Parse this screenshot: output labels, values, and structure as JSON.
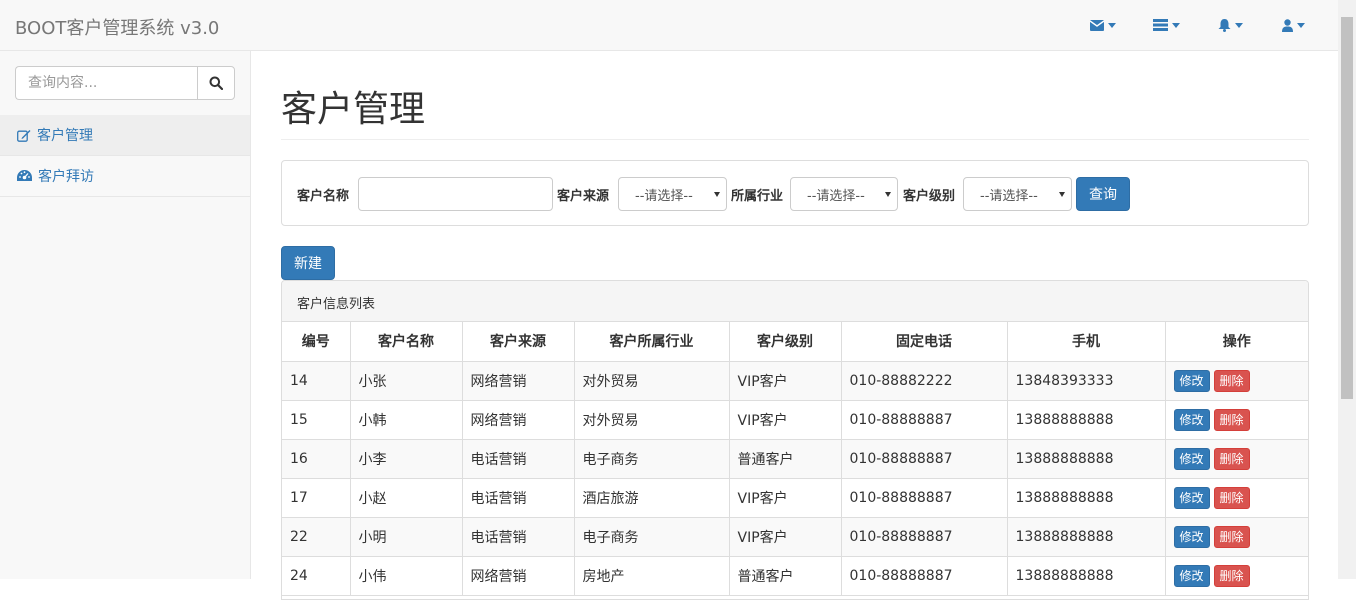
{
  "app": {
    "brand": "BOOT客户管理系统 v3.0"
  },
  "navbar": {
    "icons": [
      "envelope-icon",
      "tasks-icon",
      "bell-icon",
      "user-icon"
    ]
  },
  "sidebar": {
    "search": {
      "placeholder": "查询内容..."
    },
    "items": [
      {
        "label": "客户管理",
        "icon": "edit-icon",
        "active": true
      },
      {
        "label": "客户拜访",
        "icon": "dashboard-icon",
        "active": false
      }
    ]
  },
  "main": {
    "title": "客户管理",
    "filters": {
      "name_label": "客户名称",
      "name_value": "",
      "source_label": "客户来源",
      "source_value": "--请选择--",
      "industry_label": "所属行业",
      "industry_value": "--请选择--",
      "level_label": "客户级别",
      "level_value": "--请选择--",
      "search_button": "查询"
    },
    "new_button": "新建",
    "table": {
      "heading": "客户信息列表",
      "columns": [
        "编号",
        "客户名称",
        "客户来源",
        "客户所属行业",
        "客户级别",
        "固定电话",
        "手机",
        "操作"
      ],
      "edit_label": "修改",
      "delete_label": "删除",
      "rows": [
        [
          "14",
          "小张",
          "网络营销",
          "对外贸易",
          "VIP客户",
          "010-88882222",
          "13848393333"
        ],
        [
          "15",
          "小韩",
          "网络营销",
          "对外贸易",
          "VIP客户",
          "010-88888887",
          "13888888888"
        ],
        [
          "16",
          "小李",
          "电话营销",
          "电子商务",
          "普通客户",
          "010-88888887",
          "13888888888"
        ],
        [
          "17",
          "小赵",
          "电话营销",
          "酒店旅游",
          "VIP客户",
          "010-88888887",
          "13888888888"
        ],
        [
          "22",
          "小明",
          "电话营销",
          "电子商务",
          "VIP客户",
          "010-88888887",
          "13888888888"
        ],
        [
          "24",
          "小伟",
          "网络营销",
          "房地产",
          "普通客户",
          "010-88888887",
          "13888888888"
        ]
      ]
    }
  },
  "colors": {
    "primary": "#337ab7",
    "danger": "#d9534f"
  }
}
